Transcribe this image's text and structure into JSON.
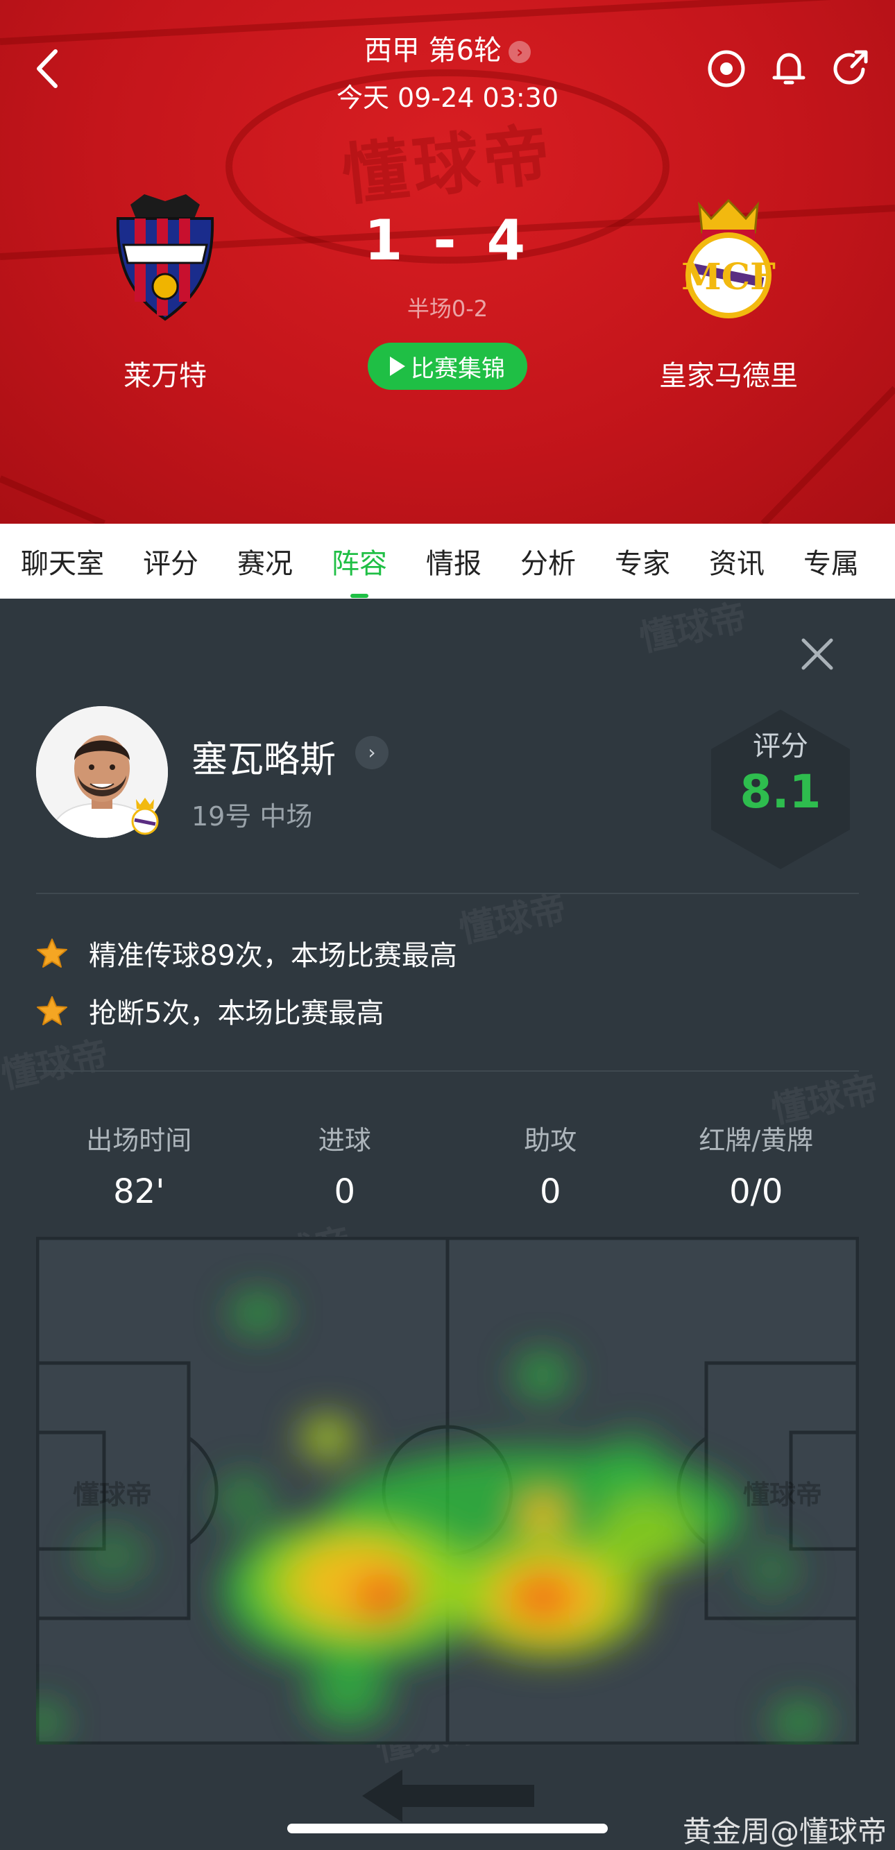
{
  "header": {
    "round_title": "西甲 第6轮",
    "match_time": "今天 09-24 03:30",
    "score": "1 - 4",
    "halftime": "半场0-2",
    "highlights_label": "比赛集锦",
    "home_team": "莱万特",
    "away_team": "皇家马德里",
    "watermark": "懂球帝",
    "icons": [
      "back-icon",
      "target-icon",
      "bell-icon",
      "share-icon"
    ]
  },
  "tabs": [
    {
      "label": "聊天室"
    },
    {
      "label": "评分"
    },
    {
      "label": "赛况"
    },
    {
      "label": "阵容",
      "active": true
    },
    {
      "label": "情报"
    },
    {
      "label": "分析"
    },
    {
      "label": "专家"
    },
    {
      "label": "资讯"
    },
    {
      "label": "专属"
    }
  ],
  "player": {
    "name": "塞瓦略斯",
    "meta": "19号 中场",
    "rating_label": "评分",
    "rating": "8.1"
  },
  "achievements": [
    "精准传球89次，本场比赛最高",
    "抢断5次，本场比赛最高"
  ],
  "stats": [
    {
      "label": "出场时间",
      "value": "82'"
    },
    {
      "label": "进球",
      "value": "0"
    },
    {
      "label": "助攻",
      "value": "0"
    },
    {
      "label": "红牌/黄牌",
      "value": "0/0"
    }
  ],
  "pitch_watermark": "懂球帝",
  "watermark": "懂球帝",
  "credit": "黄金周@懂球帝",
  "colors": {
    "header_red": "#c4151b",
    "accent_green": "#1fbf45",
    "panel_bg": "#2f383f",
    "rating_green": "#2ebd4e"
  }
}
